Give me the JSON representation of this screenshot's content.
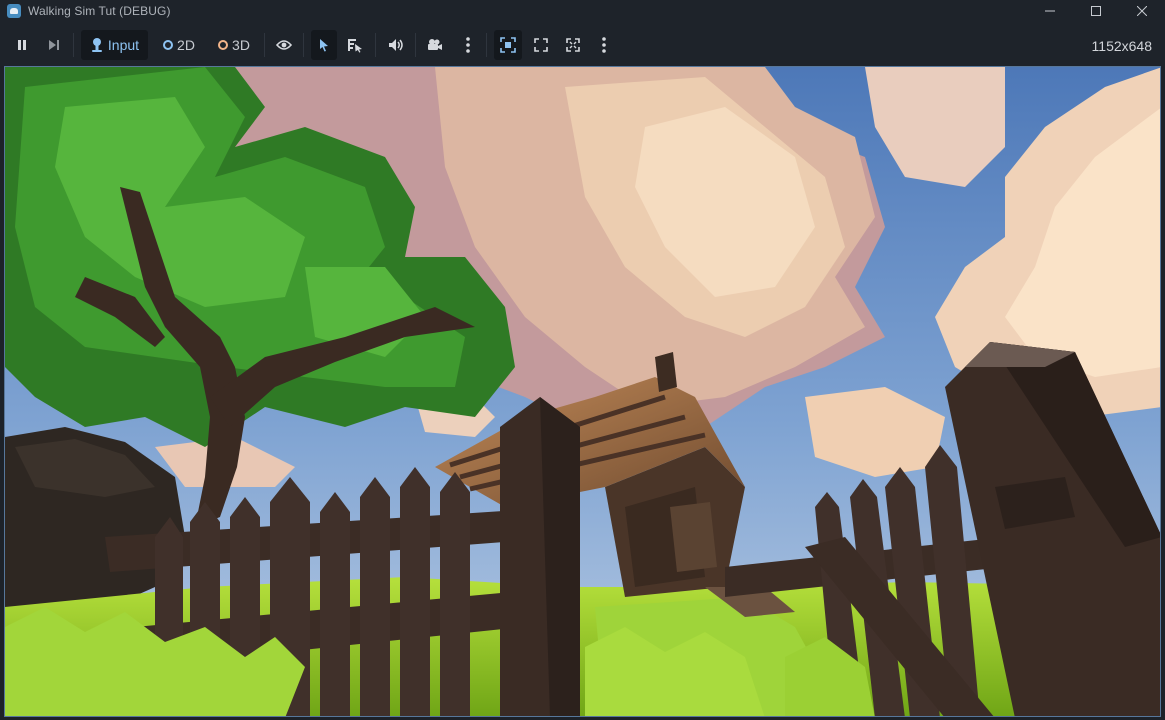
{
  "window": {
    "title": "Walking Sim Tut (DEBUG)"
  },
  "toolbar": {
    "input_label": "Input",
    "mode_2d_label": "2D",
    "mode_3d_label": "3D",
    "resolution": "1152x648"
  },
  "icons": {
    "app": "godot-logo-icon",
    "minimize": "minimize-icon",
    "maximize": "maximize-icon",
    "close": "close-icon",
    "pause": "pause-icon",
    "next_frame": "next-frame-icon",
    "input": "input-joystick-icon",
    "visibility": "eye-icon",
    "select": "cursor-arrow-icon",
    "list_select": "list-select-icon",
    "audio": "speaker-icon",
    "camera": "camera-icon",
    "more": "kebab-menu-icon",
    "embed": "embed-focus-icon",
    "expand": "expand-icon",
    "fullscreen": "fullscreen-icon"
  },
  "colors": {
    "accent": "#8ec3f2",
    "mode_3d": "#f3b58a",
    "chrome_bg": "#1e232a",
    "viewport_border": "#57779b"
  }
}
